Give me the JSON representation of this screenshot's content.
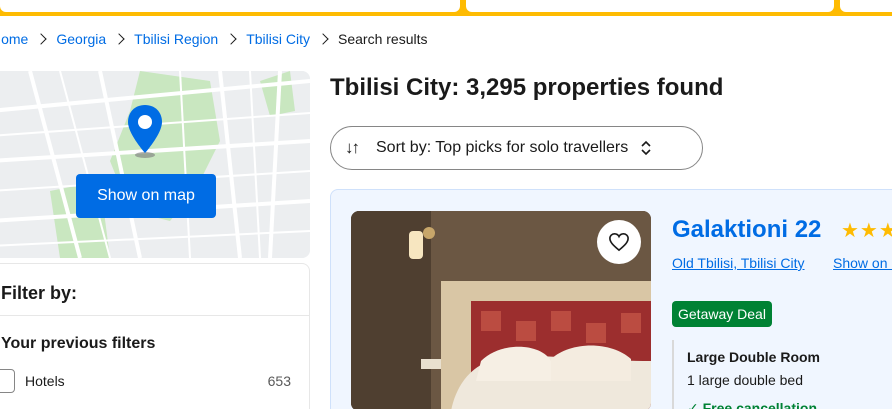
{
  "breadcrumb": {
    "items": [
      "Home",
      "Georgia",
      "Tbilisi Region",
      "Tbilisi City"
    ],
    "current": "Search results"
  },
  "map": {
    "button_label": "Show on map"
  },
  "filters": {
    "heading": "Filter by:",
    "section_title": "Your previous filters",
    "options": [
      {
        "label": "Hotels",
        "count": "653"
      }
    ]
  },
  "results": {
    "title": "Tbilisi City: 3,295 properties found",
    "sort_label": "Sort by: Top picks for solo travellers"
  },
  "property": {
    "name": "Galaktioni 22",
    "stars": "★★★",
    "location": "Old Tbilisi, Tbilisi City",
    "map_link": "Show on map",
    "deal_badge": "Getaway Deal",
    "room_name": "Large Double Room",
    "bed": "1 large double bed",
    "cancellation": "✓ Free cancellation"
  },
  "colors": {
    "brand_blue": "#006ce4",
    "yellow": "#febb02",
    "deal_green": "#008234"
  },
  "icons": {
    "sort": "sort-arrows-icon",
    "chevron": "chevron-updown-icon",
    "favorite": "heart-icon",
    "map_pin": "map-pin-icon"
  }
}
